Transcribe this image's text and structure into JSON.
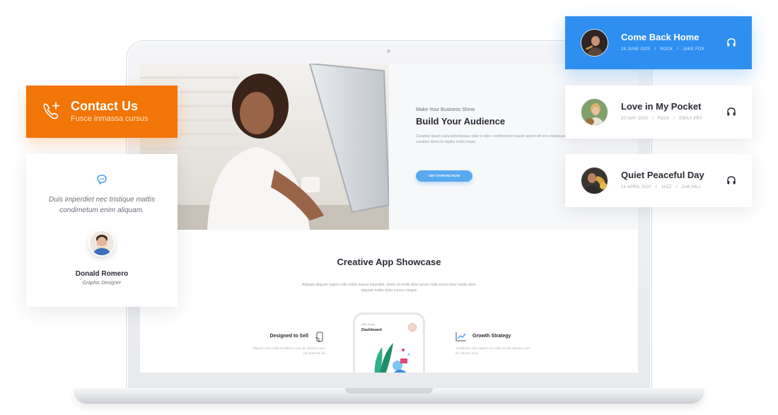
{
  "contact": {
    "title": "Contact Us",
    "subtitle": "Fusce inmassa cursus",
    "icon": "phone-plus-icon",
    "color": "#f27507"
  },
  "testimonial": {
    "icon": "chat-bubble-icon",
    "quote": "Duis imperdiet nec tristique mattis condimetum enim aliquam.",
    "name": "Donald Romero",
    "role": "Graphic Designer"
  },
  "songs": [
    {
      "title": "Come Back Home",
      "date": "24 JUNE 2020",
      "genre": "ROCK",
      "artist": "JAKE FOX",
      "icon": "headphones-icon",
      "active": true
    },
    {
      "title": "Love in My Pocket",
      "date": "20 MAY 2020",
      "genre": "FOLK",
      "artist": "EMILY FRY",
      "icon": "headphones-icon",
      "active": false
    },
    {
      "title": "Quiet Peaceful Day",
      "date": "14 APRIL 2020",
      "genre": "JAZZ",
      "artist": "ZAK HILL",
      "icon": "headphones-icon",
      "active": false
    }
  ],
  "accent_color": "#2f8ff0",
  "screen": {
    "hero": {
      "kicker": "Make Your Business Shine",
      "title": "Build Your Audience",
      "body": "Curabitur ipsum nulla pellentesque vitae in dolor condimentum sapien aptent elit eros malesuada et class fermentesi curabitur libero id sagittis morbi risque",
      "button": "GET STARTED NOW"
    },
    "showcase": {
      "title": "Creative App Showcase",
      "body": "Aliquam aliquam sapien odio mollis massa imperdiet, donec ut mollis dolor ipsum nulla consectetur mattis dolor aliquam mattis dolor cursus congue"
    },
    "features": [
      {
        "title": "Designed to Sell",
        "icon": "hand-phone-icon",
        "body": "Aliquam erat mollis et ultrices nunc do ultricies nunc per pulvinar dui"
      },
      {
        "title": "Growth Strategy",
        "icon": "chart-line-icon",
        "body": "Vestibulum sem aptent est mollis in nisi ultricies nunc do ultricies nunc"
      }
    ],
    "phone": {
      "kicker": "Hello Susan",
      "title": "Dashboard"
    }
  }
}
